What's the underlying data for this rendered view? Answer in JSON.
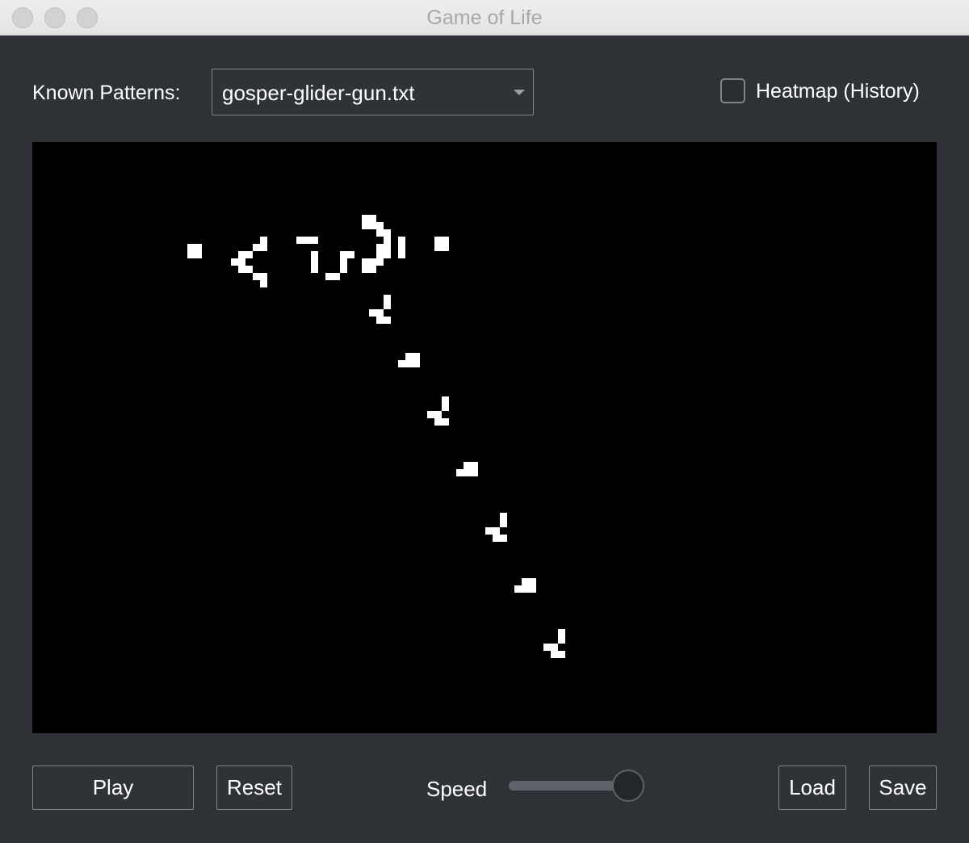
{
  "window": {
    "title": "Game of Life"
  },
  "controls": {
    "patterns_label": "Known Patterns:",
    "selected_pattern": "gosper-glider-gun.txt",
    "heatmap_label": "Heatmap (History)",
    "heatmap_checked": false
  },
  "bottom_bar": {
    "play_label": "Play",
    "reset_label": "Reset",
    "speed_label": "Speed",
    "speed_level": 0.9,
    "load_label": "Load",
    "save_label": "Save"
  },
  "colors": {
    "window_bg": "#2e3135",
    "board_bg": "#000000",
    "live_cell": "#ffffff"
  }
}
